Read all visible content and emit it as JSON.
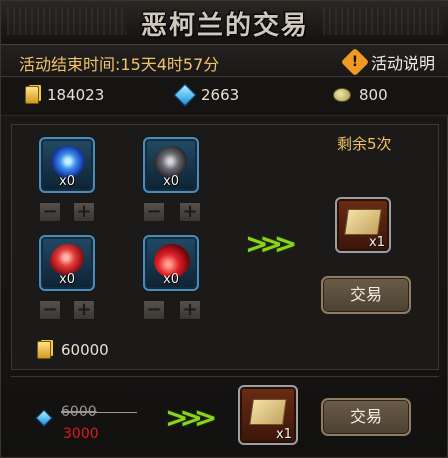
{
  "title": "恶柯兰的交易",
  "info": {
    "end_time": "活动结束时间:15天4时57分",
    "help_icon": "exclamation-diamond-icon",
    "help_glyph": "!",
    "help_label": "活动说明"
  },
  "currencies": [
    {
      "name": "gold",
      "icon": "gold-ingot-icon",
      "value": "184023"
    },
    {
      "name": "gem",
      "icon": "blue-gem-icon",
      "value": "2663"
    },
    {
      "name": "coin",
      "icon": "coin-icon",
      "value": "800"
    }
  ],
  "trade1": {
    "remaining": "剩余5次",
    "materials": [
      {
        "icon": "blue-orb-icon",
        "qty": "x0"
      },
      {
        "icon": "dark-orb-icon",
        "qty": "x0"
      },
      {
        "icon": "red-orb-icon",
        "qty": "x0"
      },
      {
        "icon": "blood-drop-icon",
        "qty": "x0"
      }
    ],
    "minus": "−",
    "plus": "+",
    "result": {
      "icon": "scroll-icon",
      "qty": "x1"
    },
    "button": "交易",
    "gold_cost": "60000",
    "arrow": ">>>"
  },
  "trade2": {
    "old_price": "6000",
    "new_price": "3000",
    "result": {
      "icon": "scroll-icon",
      "qty": "x1"
    },
    "button": "交易",
    "arrow": ">>>"
  },
  "colors": {
    "accent_gold": "#f0c36a",
    "arrow_green": "#8ad41f",
    "discount_red": "#e01b1b"
  }
}
